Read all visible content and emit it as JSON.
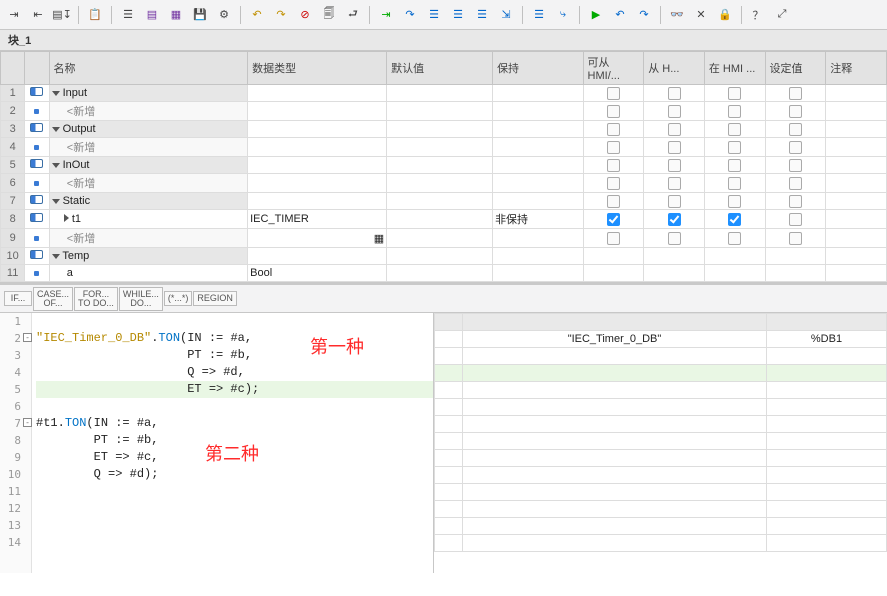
{
  "block_title": "块_1",
  "toolbar_icons": [
    "indent",
    "outdent",
    "export",
    "import",
    "copy",
    "hsplit",
    "db1",
    "db2",
    "save",
    "settings",
    "undo",
    "redo",
    "stop",
    "find",
    "back",
    "run",
    "step-in",
    "step-over",
    "step-out",
    "bp",
    "bp-list",
    "bp-en",
    "watch",
    "goto",
    "keys",
    "cross",
    "lock",
    "help",
    "expand",
    "rec"
  ],
  "columns": [
    "名称",
    "数据类型",
    "默认值",
    "保持",
    "可从 HMI/...",
    "从 H...",
    "在 HMI ...",
    "设定值",
    "注释"
  ],
  "rows": [
    {
      "n": 1,
      "kind": "section",
      "ic": "tag",
      "exp": "down",
      "name": "Input",
      "chk": [
        0,
        0,
        0,
        0
      ]
    },
    {
      "n": 2,
      "kind": "add",
      "ic": "dot",
      "name": "<新增",
      "chk": [
        0,
        0,
        0,
        0
      ]
    },
    {
      "n": 3,
      "kind": "section",
      "ic": "tag",
      "exp": "down",
      "name": "Output",
      "chk": [
        0,
        0,
        0,
        0
      ]
    },
    {
      "n": 4,
      "kind": "add",
      "ic": "dot",
      "name": "<新增",
      "chk": [
        0,
        0,
        0,
        0
      ]
    },
    {
      "n": 5,
      "kind": "section",
      "ic": "tag",
      "exp": "down",
      "name": "InOut",
      "chk": [
        0,
        0,
        0,
        0
      ]
    },
    {
      "n": 6,
      "kind": "add",
      "ic": "dot",
      "name": "<新增",
      "chk": [
        0,
        0,
        0,
        0
      ]
    },
    {
      "n": 7,
      "kind": "section",
      "ic": "tag",
      "exp": "down",
      "name": "Static",
      "chk": [
        0,
        0,
        0,
        0
      ]
    },
    {
      "n": 8,
      "kind": "var",
      "ic": "tag",
      "exp": "right",
      "name": "t1",
      "type": "IEC_TIMER",
      "ret": "非保持",
      "chk": [
        1,
        1,
        1,
        0
      ]
    },
    {
      "n": 9,
      "kind": "add",
      "ic": "dot",
      "name": "<新增",
      "chk": [
        0,
        0,
        0,
        0
      ]
    },
    {
      "n": 10,
      "kind": "section",
      "ic": "tag",
      "exp": "down",
      "name": "Temp",
      "chk": [
        "",
        "",
        "",
        ""
      ]
    },
    {
      "n": 11,
      "kind": "var",
      "ic": "dot",
      "name": "a",
      "type": "Bool",
      "chk": [
        "",
        "",
        "",
        ""
      ]
    }
  ],
  "snippets": [
    "IF...",
    "CASE... OF...",
    "FOR... TO DO...",
    "WHILE... DO...",
    "(*...*)",
    "REGION"
  ],
  "code": [
    "",
    "\"IEC_Timer_0_DB\".TON(IN := #a,",
    "                     PT := #b,",
    "                     Q => #d,",
    "                     ET => #c);",
    "",
    "#t1.TON(IN := #a,",
    "        PT := #b,",
    "        ET => #c,",
    "        Q => #d);",
    "",
    "",
    "",
    ""
  ],
  "highlight_line": 5,
  "fold_lines": [
    2,
    7
  ],
  "red_labels": {
    "a": "第一种",
    "b": "第二种"
  },
  "ref": {
    "name": "\"IEC_Timer_0_DB\"",
    "addr": "%DB1"
  }
}
